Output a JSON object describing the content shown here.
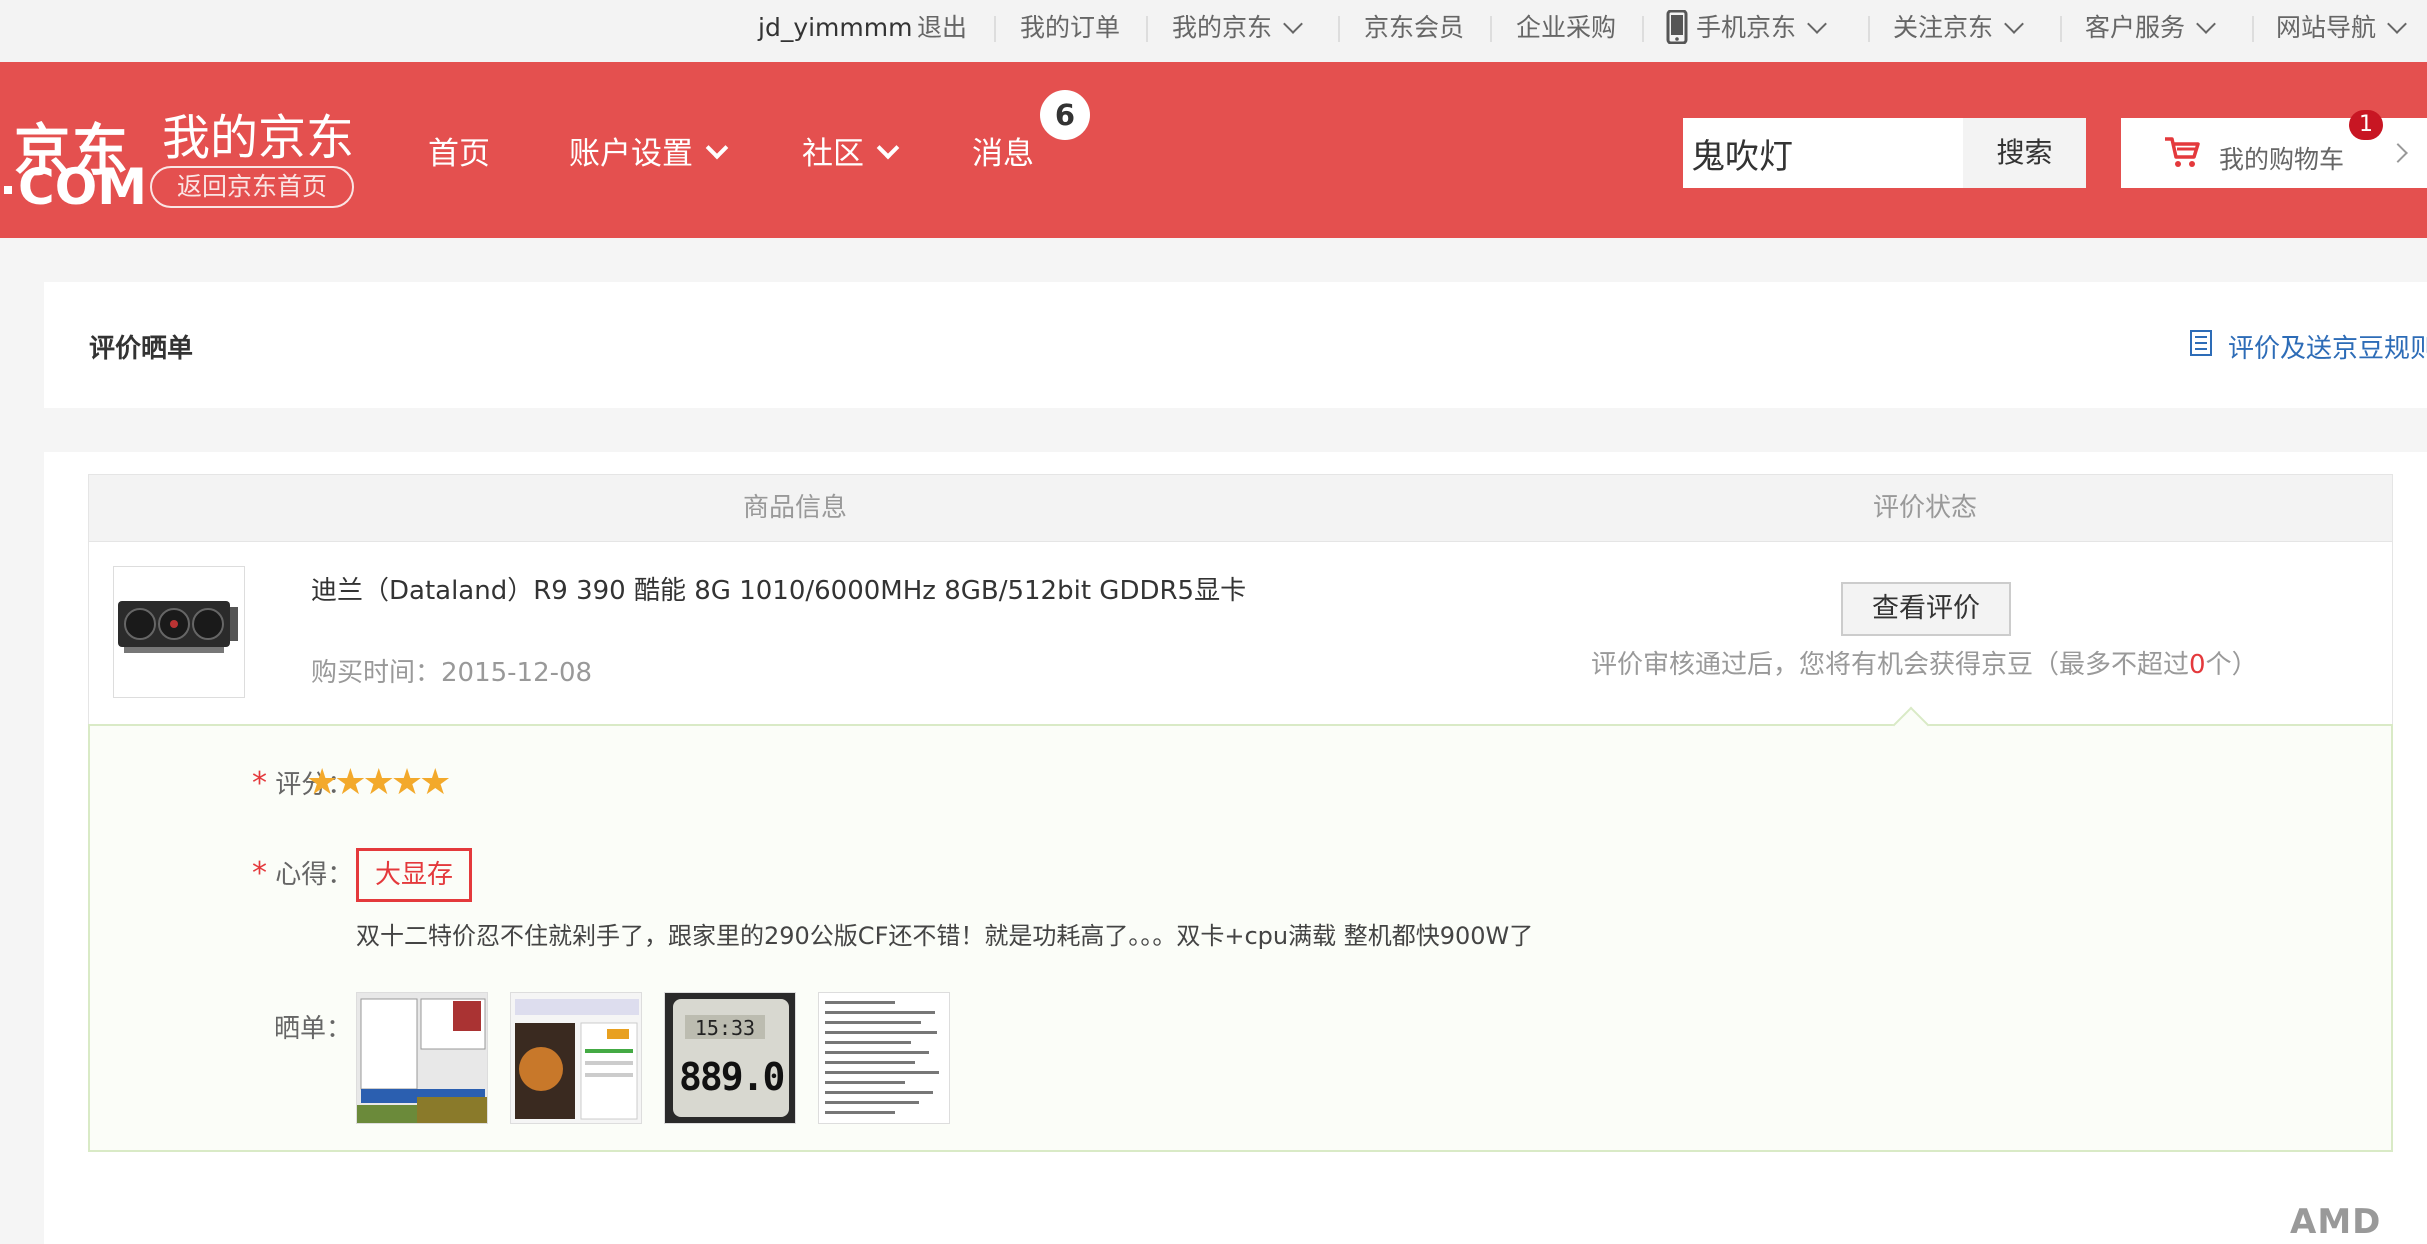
{
  "topbar": {
    "username": "jd_yimmmm",
    "logout": "退出",
    "my_orders": "我的订单",
    "my_jd": "我的京东",
    "jd_member": "京东会员",
    "enterprise": "企业采购",
    "mobile_jd": "手机京东",
    "follow_jd": "关注京东",
    "customer_service": "客户服务",
    "site_nav": "网站导航"
  },
  "header": {
    "logo_top": "京东",
    "logo_bottom": "COM",
    "my_jd_title": "我的京东",
    "back_home": "返回京东首页",
    "nav": {
      "home": "首页",
      "account": "账户设置",
      "community": "社区",
      "messages": "消息",
      "messages_badge": "6"
    },
    "search": {
      "value": "鬼吹灯",
      "button": "搜索"
    },
    "cart": {
      "label": "我的购物车",
      "count": "1"
    }
  },
  "page": {
    "title": "评价晒单",
    "rules_link": "评价及送京豆规则"
  },
  "table": {
    "headers": {
      "product": "商品信息",
      "status": "评价状态"
    }
  },
  "product": {
    "name": "迪兰（Dataland）R9 390 酷能 8G 1010/6000MHz 8GB/512bit GDDR5显卡",
    "purchase_date": "购买时间：2015-12-08",
    "view_review_button": "查看评价",
    "hint_prefix": "评价审核通过后，您将有机会获得京豆（最多不超过",
    "hint_value": "0",
    "hint_suffix": "个）"
  },
  "review": {
    "score_label": "评分：",
    "rating": 5,
    "rating_max": 5,
    "experience_label": "心得：",
    "tag": "大显存",
    "text": "双十二特价忍不住就剁手了，跟家里的290公版CF还不错！就是功耗高了。。。双卡+cpu满载 整机都快900W了",
    "photos_label": "晒单：",
    "photo_count": 4,
    "photo3_display": "889.0"
  },
  "colors": {
    "brand_red": "#e4504f",
    "link_blue": "#2d6cb7",
    "alert_red": "#e4393c",
    "star": "#f3a92b"
  },
  "watermark": "AMD"
}
